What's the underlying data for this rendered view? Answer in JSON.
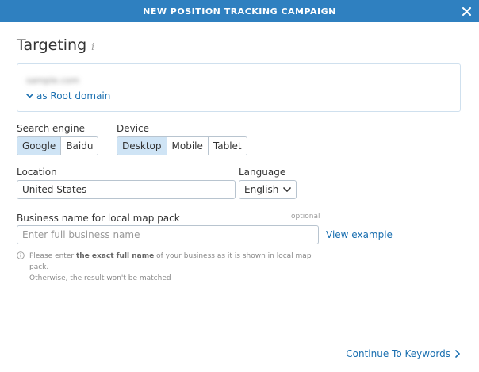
{
  "header": {
    "title": "NEW POSITION TRACKING CAMPAIGN",
    "close_icon": "close-icon"
  },
  "section": {
    "heading": "Targeting",
    "info_icon": "info-icon"
  },
  "domain": {
    "value": "sample.com",
    "scope_label": "as Root domain"
  },
  "search_engine": {
    "label": "Search engine",
    "options": [
      "Google",
      "Baidu"
    ],
    "selected": "Google"
  },
  "device": {
    "label": "Device",
    "options": [
      "Desktop",
      "Mobile",
      "Tablet"
    ],
    "selected": "Desktop"
  },
  "location": {
    "label": "Location",
    "value": "United States"
  },
  "language": {
    "label": "Language",
    "value": "English"
  },
  "business": {
    "label": "Business name for local map pack",
    "optional_label": "optional",
    "placeholder": "Enter full business name",
    "view_example": "View example",
    "hint_prefix": "Please enter ",
    "hint_bold": "the exact full name",
    "hint_suffix": " of your business as it is shown in local map pack.",
    "hint_line2": "Otherwise, the result won't be matched"
  },
  "footer": {
    "continue_label": "Continue To Keywords"
  },
  "colors": {
    "header_bg": "#2f80c0",
    "link": "#1a6fb0",
    "active_segment": "#cfe4f5"
  }
}
